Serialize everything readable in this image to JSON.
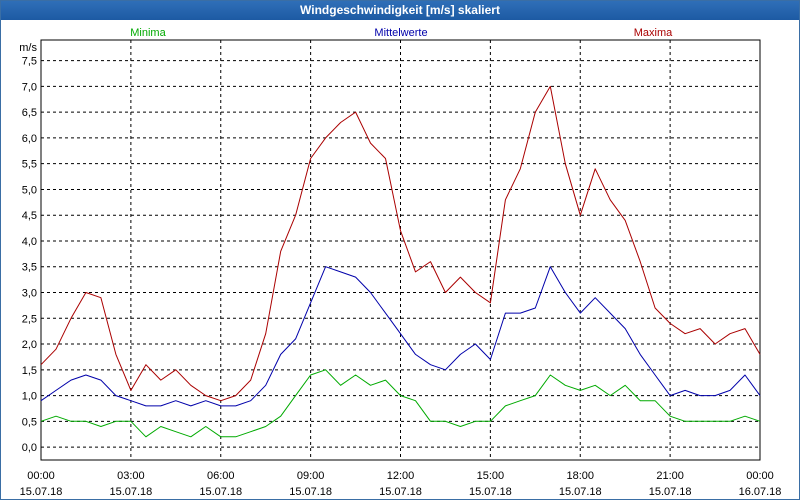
{
  "window": {
    "title": "Windgeschwindigkeit [m/s] skaliert"
  },
  "chart_data": {
    "type": "line",
    "title": "Windgeschwindigkeit [m/s] skaliert",
    "ylabel": "m/s",
    "ylim": [
      -0.25,
      7.9
    ],
    "xlim": [
      0,
      24
    ],
    "grid": true,
    "legend_position": "top",
    "yticks": [
      {
        "value": 0.0,
        "label": "0,0"
      },
      {
        "value": 0.5,
        "label": "0,5"
      },
      {
        "value": 1.0,
        "label": "1,0"
      },
      {
        "value": 1.5,
        "label": "1,5"
      },
      {
        "value": 2.0,
        "label": "2,0"
      },
      {
        "value": 2.5,
        "label": "2,5"
      },
      {
        "value": 3.0,
        "label": "3,0"
      },
      {
        "value": 3.5,
        "label": "3,5"
      },
      {
        "value": 4.0,
        "label": "4,0"
      },
      {
        "value": 4.5,
        "label": "4,5"
      },
      {
        "value": 5.0,
        "label": "5,0"
      },
      {
        "value": 5.5,
        "label": "5,5"
      },
      {
        "value": 6.0,
        "label": "6,0"
      },
      {
        "value": 6.5,
        "label": "6,5"
      },
      {
        "value": 7.0,
        "label": "7,0"
      },
      {
        "value": 7.5,
        "label": "7,5"
      }
    ],
    "xticks": [
      {
        "time": "00:00",
        "date": "15.07.18"
      },
      {
        "time": "03:00",
        "date": "15.07.18"
      },
      {
        "time": "06:00",
        "date": "15.07.18"
      },
      {
        "time": "09:00",
        "date": "15.07.18"
      },
      {
        "time": "12:00",
        "date": "15.07.18"
      },
      {
        "time": "15:00",
        "date": "15.07.18"
      },
      {
        "time": "18:00",
        "date": "15.07.18"
      },
      {
        "time": "21:00",
        "date": "15.07.18"
      },
      {
        "time": "00:00",
        "date": "16.07.18"
      }
    ],
    "series": [
      {
        "name": "Minima",
        "color": "#00aa00",
        "x": [
          0,
          0.5,
          1,
          1.5,
          2,
          2.5,
          3,
          3.5,
          4,
          4.5,
          5,
          5.5,
          6,
          6.5,
          7,
          7.5,
          8,
          8.5,
          9,
          9.5,
          10,
          10.5,
          11,
          11.5,
          12,
          12.5,
          13,
          13.5,
          14,
          14.5,
          15,
          15.5,
          16,
          16.5,
          17,
          17.5,
          18,
          18.5,
          19,
          19.5,
          20,
          20.5,
          21,
          21.5,
          22,
          22.5,
          23,
          23.5,
          24
        ],
        "values": [
          0.5,
          0.6,
          0.5,
          0.5,
          0.4,
          0.5,
          0.5,
          0.2,
          0.4,
          0.3,
          0.2,
          0.4,
          0.2,
          0.2,
          0.3,
          0.4,
          0.6,
          1.0,
          1.4,
          1.5,
          1.2,
          1.4,
          1.2,
          1.3,
          1.0,
          0.9,
          0.5,
          0.5,
          0.4,
          0.5,
          0.5,
          0.8,
          0.9,
          1.0,
          1.4,
          1.2,
          1.1,
          1.2,
          1.0,
          1.2,
          0.9,
          0.9,
          0.6,
          0.5,
          0.5,
          0.5,
          0.5,
          0.6,
          0.5
        ]
      },
      {
        "name": "Mittelwerte",
        "color": "#0000aa",
        "x": [
          0,
          0.5,
          1,
          1.5,
          2,
          2.5,
          3,
          3.5,
          4,
          4.5,
          5,
          5.5,
          6,
          6.5,
          7,
          7.5,
          8,
          8.5,
          9,
          9.5,
          10,
          10.5,
          11,
          11.5,
          12,
          12.5,
          13,
          13.5,
          14,
          14.5,
          15,
          15.5,
          16,
          16.5,
          17,
          17.5,
          18,
          18.5,
          19,
          19.5,
          20,
          20.5,
          21,
          21.5,
          22,
          22.5,
          23,
          23.5,
          24
        ],
        "values": [
          0.9,
          1.1,
          1.3,
          1.4,
          1.3,
          1.0,
          0.9,
          0.8,
          0.8,
          0.9,
          0.8,
          0.9,
          0.8,
          0.8,
          0.9,
          1.2,
          1.8,
          2.1,
          2.8,
          3.5,
          3.4,
          3.3,
          3.0,
          2.6,
          2.2,
          1.8,
          1.6,
          1.5,
          1.8,
          2.0,
          1.7,
          2.6,
          2.6,
          2.7,
          3.5,
          3.0,
          2.6,
          2.9,
          2.6,
          2.3,
          1.8,
          1.4,
          1.0,
          1.1,
          1.0,
          1.0,
          1.1,
          1.4,
          1.0
        ]
      },
      {
        "name": "Maxima",
        "color": "#aa0000",
        "x": [
          0,
          0.5,
          1,
          1.5,
          2,
          2.5,
          3,
          3.5,
          4,
          4.5,
          5,
          5.5,
          6,
          6.5,
          7,
          7.5,
          8,
          8.5,
          9,
          9.5,
          10,
          10.5,
          11,
          11.5,
          12,
          12.5,
          13,
          13.5,
          14,
          14.5,
          15,
          15.5,
          16,
          16.5,
          17,
          17.5,
          18,
          18.5,
          19,
          19.5,
          20,
          20.5,
          21,
          21.5,
          22,
          22.5,
          23,
          23.5,
          24
        ],
        "values": [
          1.6,
          1.9,
          2.5,
          3.0,
          2.9,
          1.8,
          1.1,
          1.6,
          1.3,
          1.5,
          1.2,
          1.0,
          0.9,
          1.0,
          1.3,
          2.2,
          3.8,
          4.5,
          5.6,
          6.0,
          6.3,
          6.5,
          5.9,
          5.6,
          4.2,
          3.4,
          3.6,
          3.0,
          3.3,
          3.0,
          2.8,
          4.8,
          5.4,
          6.5,
          7.0,
          5.5,
          4.5,
          5.4,
          4.8,
          4.4,
          3.6,
          2.7,
          2.4,
          2.2,
          2.3,
          2.0,
          2.2,
          2.3,
          1.8
        ]
      }
    ]
  }
}
